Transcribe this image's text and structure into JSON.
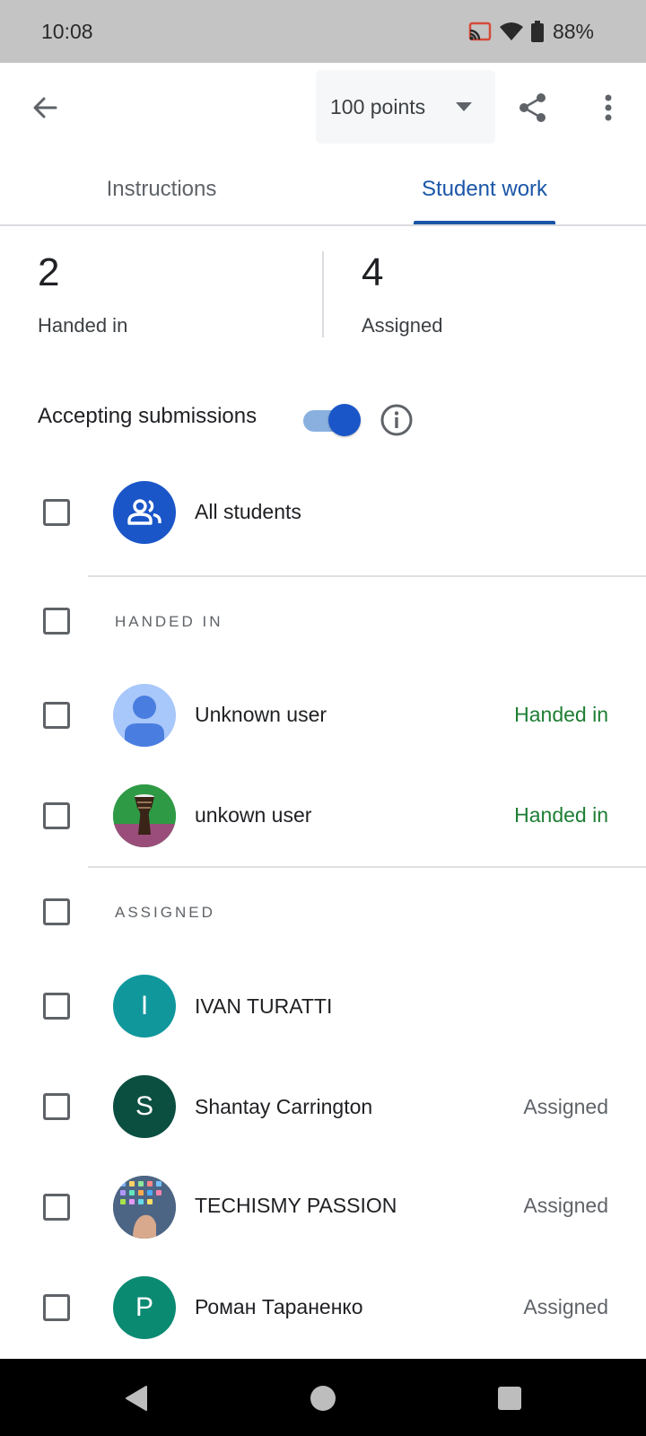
{
  "status_bar": {
    "time": "10:08",
    "battery": "88%",
    "icons": [
      "cast-icon",
      "wifi-icon",
      "battery-icon"
    ]
  },
  "app_bar": {
    "points_label": "100 points",
    "icons": [
      "back-arrow-icon",
      "chevron-down-icon",
      "share-icon",
      "more-vert-icon"
    ]
  },
  "tabs": [
    {
      "label": "Instructions",
      "selected": false
    },
    {
      "label": "Student work",
      "selected": true
    }
  ],
  "stats": [
    {
      "number": "2",
      "label": "Handed in"
    },
    {
      "number": "4",
      "label": "Assigned"
    }
  ],
  "submissions": {
    "label": "Accepting submissions",
    "toggle_on": true
  },
  "all_students": {
    "label": "All students"
  },
  "sections": {
    "handed_in": "HANDED IN",
    "assigned": "ASSIGNED"
  },
  "handed_in_students": [
    {
      "name": "Unknown user",
      "status": "Handed in",
      "avatar": "default-person"
    },
    {
      "name": "unkown user",
      "status": "Handed in",
      "avatar": "photo-drum"
    }
  ],
  "assigned_students": [
    {
      "name": "IVAN TURATTI",
      "status": "",
      "initial": "I",
      "color": "#10979c"
    },
    {
      "name": "Shantay Carrington",
      "status": "Assigned",
      "initial": "S",
      "color": "#0b4f41"
    },
    {
      "name": "TECHISMY PASSION",
      "status": "Assigned",
      "avatar": "photo-phone"
    },
    {
      "name": "Роман Тараненко",
      "status": "Assigned",
      "initial": "P",
      "color": "#0b8a72"
    }
  ],
  "colors": {
    "accent": "#1a56a8",
    "handed_in_status": "#1e7e34",
    "all_students_avatar": "#1a56c8"
  }
}
